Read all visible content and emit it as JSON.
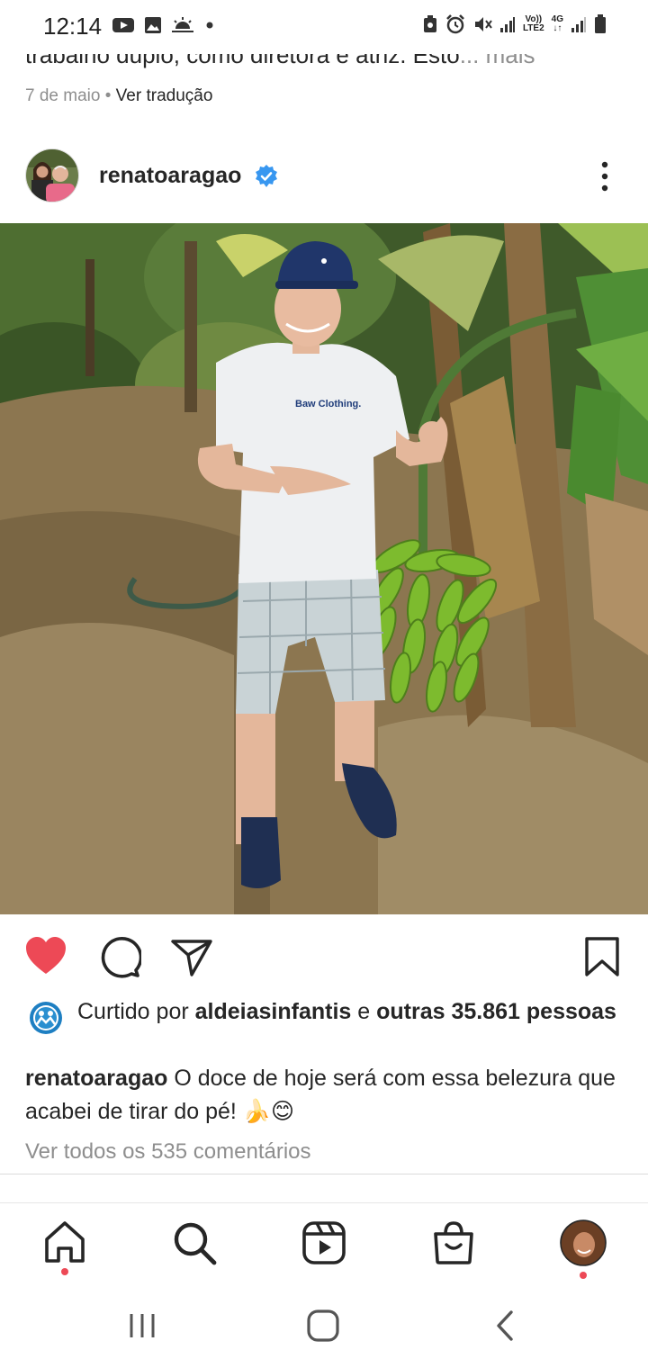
{
  "status_bar": {
    "time": "12:14",
    "network_top": "Vo))",
    "network_bottom": "LTE2",
    "data_top": "4G",
    "data_bottom": "↓↑"
  },
  "previous_post": {
    "caption_text": "trabalho duplo, como diretora e atriz. Esto",
    "more_label": "... mais",
    "date": "7 de maio",
    "separator": "•",
    "translate_label": "Ver tradução"
  },
  "post": {
    "username": "renatoaragao",
    "verified": true,
    "photo_shirt_text": "Baw Clothing.",
    "likes": {
      "prefix": "Curtido por",
      "liker": "aldeiasinfantis",
      "conj": "e",
      "others": "outras 35.861",
      "suffix": "pessoas"
    },
    "caption": {
      "username": "renatoaragao",
      "text": "O doce de hoje será com essa belezura que acabei de tirar do pé! 🍌😊"
    },
    "comments_link": "Ver todos os 535 comentários",
    "liked": true
  },
  "colors": {
    "like_red": "#ed4956",
    "verified_blue": "#3897f0",
    "secondary_text": "#8e8e8e",
    "primary_text": "#262626"
  },
  "bottom_nav": {
    "items": [
      "home-icon",
      "search-icon",
      "reels-icon",
      "shop-icon",
      "profile-avatar"
    ]
  },
  "system_nav": {
    "items": [
      "recents-icon",
      "home-icon",
      "back-icon"
    ]
  }
}
